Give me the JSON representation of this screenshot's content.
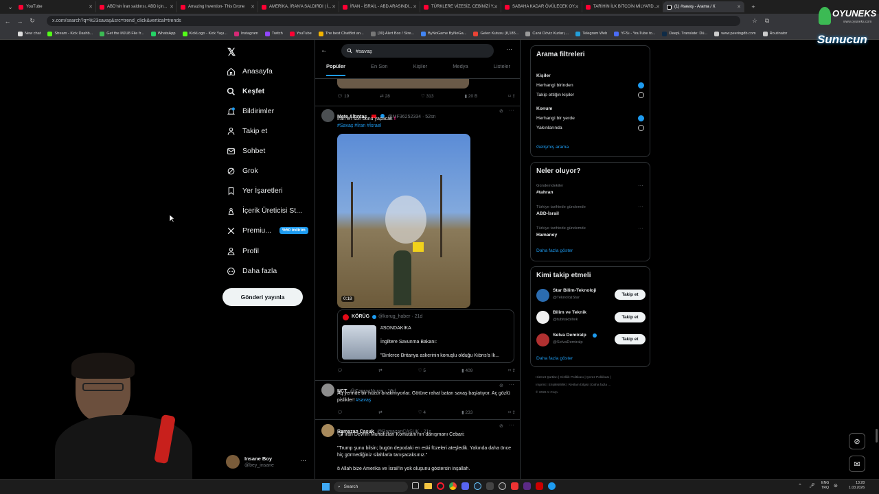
{
  "browser": {
    "tabs": [
      {
        "label": "YouTube"
      },
      {
        "label": "ABD'nin İran saldırısı, ABD için..."
      },
      {
        "label": "Amazing Invention- This Drone"
      },
      {
        "label": "AMERİKA, İRAN'A SALDIRDI | İ..."
      },
      {
        "label": "İRAN - İSRAİL - ABD ARASINDI..."
      },
      {
        "label": "TÜRKLERE VİZESİZ, CEBİNİZİ Y..."
      },
      {
        "label": "SABAHA KADAR ÖVÜLECEK OY..."
      },
      {
        "label": "TARİHİN İLK BİTCOİN MİLYARD..."
      },
      {
        "label": "(1) #savaş - Arama / X"
      }
    ],
    "url": "x.com/search?q=%23savaş&src=trend_click&vertical=trends",
    "bookmarks": [
      "New chat",
      "Stream - Kick Dashb...",
      "Get the MJU8 File fr...",
      "WhatsApp",
      "KickLogo - Kick Yayı...",
      "Instagram",
      "Twitch",
      "YouTube",
      "The best ChatBot an...",
      "(30) Alert Box / Stre...",
      "ByNoGame ByNoGa...",
      "Gelen Kutusu (8,185...",
      "Canlı Döviz Kurları,...",
      "Telegram Web",
      "YFSı - YouTube to...",
      "DeepL Translate: Dü...",
      "www.peeringdb.com",
      "Routinator"
    ]
  },
  "overlay": {
    "brand_top": "OYUNEKS",
    "brand_top_sub": "www.oyuneks.com",
    "brand_bottom": "Sunucun"
  },
  "nav": {
    "items": [
      {
        "label": "Anasayfa"
      },
      {
        "label": "Keşfet"
      },
      {
        "label": "Bildirimler"
      },
      {
        "label": "Takip et"
      },
      {
        "label": "Sohbet"
      },
      {
        "label": "Grok"
      },
      {
        "label": "Yer İşaretleri"
      },
      {
        "label": "İçerik Üreticisi St..."
      },
      {
        "label": "Premiu..."
      },
      {
        "label": "Profil"
      },
      {
        "label": "Daha fazla"
      }
    ],
    "premium_badge": "%50 indirim",
    "post_button": "Gönderi yayınla",
    "user_name": "Insane Boy",
    "user_handle": "@bey_insane"
  },
  "search": {
    "value": "#savaş",
    "tabs": [
      "Popüler",
      "En Son",
      "Kişiler",
      "Medya",
      "Listeler"
    ],
    "active_tab": "Popüler"
  },
  "tweets": [
    {
      "actions": {
        "reply": "19",
        "retweet": "28",
        "like": "313",
        "views": "20 B"
      }
    },
    {
      "name": "Mete Altıntaş",
      "handle": "@MF36252334 · 52sn",
      "text": "İran en son bunu yapacak",
      "tags": "#Savaş #İran #İsrael",
      "video_time": "0:18",
      "quote": {
        "name": "KÖRÜG",
        "handle": "@korug_haber · 21d",
        "line1": "#SONDAKİKA",
        "line2": "İngiltere Savunma Bakanı:",
        "line3": "\"Binlerce Britanya askerinin konuşlu olduğu Kıbrıs'a İk..."
      },
      "actions": {
        "reply": "",
        "retweet": "",
        "like": "5",
        "views": "409"
      }
    },
    {
      "name": "NCT",
      "handle": "@CaprazNuray · 19d",
      "text": "Aq yerinde bir huzur bırakmıyorlar. Götüne rahat batan savaş başlatıyor. Aç gözlü pislikler!",
      "tag": "#savaş",
      "actions": {
        "reply": "",
        "retweet": "",
        "like": "4",
        "views": "233"
      }
    },
    {
      "name": "Ramazan Casuk",
      "handle": "@RamazanCASUK · 21s",
      "line1": "İran Devrim Muhafızları Komutanı'nın danışmanı Cebari:",
      "line2": "\"Trump şunu bilsin; bugün depodaki en eski füzeleri ateşledik. Yakında daha önce hiç görmediğiniz silahlarla tanışacaksınız.\"",
      "line3": "Allah bize Amerika ve İsrail'in yok oluşunu göstersin inşallah."
    }
  ],
  "filters": {
    "title": "Arama filtreleri",
    "people_label": "Kişiler",
    "people_opt1": "Herhangi birinden",
    "people_opt2": "Takip ettiğin kişiler",
    "location_label": "Konum",
    "loc_opt1": "Herhangi bir yerde",
    "loc_opt2": "Yakınlarında",
    "advanced": "Gelişmiş arama"
  },
  "trends": {
    "title": "Neler oluyor?",
    "items": [
      {
        "context": "Gündemdekiler",
        "name": "#tahran"
      },
      {
        "context": "Türkiye tarihinde gündemde",
        "name": "ABD-İsrail"
      },
      {
        "context": "Türkiye tarihinde gündemde",
        "name": "Hamaney"
      }
    ],
    "show_more": "Daha fazla göster"
  },
  "who_to_follow": {
    "title": "Kimi takip etmeli",
    "items": [
      {
        "name": "Star Bilim-Teknoloji",
        "handle": "@TeknolojiStar",
        "button": "Takip et"
      },
      {
        "name": "Bilim ve Teknik",
        "handle": "@tubitakbiltek",
        "button": "Takip et"
      },
      {
        "name": "Selva Demiralp",
        "handle": "@SelvaDemiralp",
        "button": "Takip et"
      }
    ],
    "show_more": "Daha fazla göster"
  },
  "footer": {
    "line1": [
      "Hizmet Şartları",
      "Gizlilik Politikası",
      "Çerez Politikası"
    ],
    "line2": [
      "Imprint",
      "Erişilebilirlik",
      "Reklam bilgisi",
      "Daha fazla ..."
    ],
    "copyright": "© 2026 X Corp."
  },
  "taskbar": {
    "search": "Search",
    "lang": "ENG",
    "lang2": "TRQ",
    "time": "13:28",
    "date": "1.03.2026"
  },
  "colors": {
    "accent": "#1d9bf0",
    "background": "#000000",
    "border": "#2f3336",
    "muted": "#71767b",
    "premium_badge": "#1d9bf0"
  }
}
